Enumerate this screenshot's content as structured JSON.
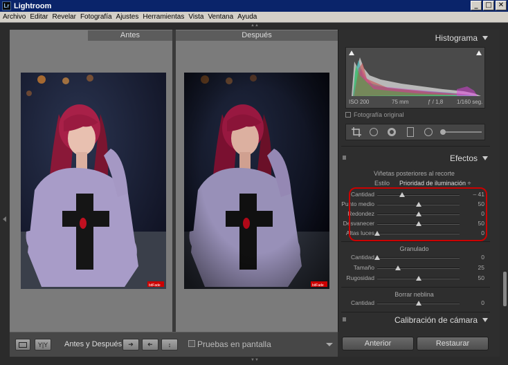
{
  "window": {
    "title": "Lightroom",
    "app_icon": "Lr",
    "min": "_",
    "max": "□",
    "close": "✕"
  },
  "menu": [
    "Archivo",
    "Editar",
    "Revelar",
    "Fotografía",
    "Ajustes",
    "Herramientas",
    "Vista",
    "Ventana",
    "Ayuda"
  ],
  "compare": {
    "before_label": "Antes",
    "after_label": "Después",
    "watermark": "bitFade"
  },
  "toolbar": {
    "view_label": "Y|Y",
    "before_after_label": "Antes y Después:",
    "soft_proof_label": "Pruebas en pantalla"
  },
  "histogram": {
    "title": "Histograma",
    "iso": "ISO 200",
    "focal": "75 mm",
    "aperture": "ƒ / 1,8",
    "shutter": "1/160 seg.",
    "original_photo": "Fotografía original"
  },
  "effects": {
    "title": "Efectos",
    "vignette_title": "Viñetas posteriores al recorte",
    "style_label": "Estilo",
    "style_value": "Prioridad de iluminación ÷",
    "vignette": [
      {
        "label": "Cantidad",
        "value": "– 41",
        "pos": 0.3
      },
      {
        "label": "Punto medio",
        "value": "50",
        "pos": 0.5
      },
      {
        "label": "Redondez",
        "value": "0",
        "pos": 0.5
      },
      {
        "label": "Desvanecer",
        "value": "50",
        "pos": 0.5
      },
      {
        "label": "Altas luces",
        "value": "0",
        "pos": 0.0
      }
    ],
    "grain_title": "Granulado",
    "grain": [
      {
        "label": "Cantidad",
        "value": "0",
        "pos": 0.0
      },
      {
        "label": "Tamaño",
        "value": "25",
        "pos": 0.25
      },
      {
        "label": "Rugosidad",
        "value": "50",
        "pos": 0.5
      }
    ],
    "dehaze_title": "Borrar neblina",
    "dehaze": [
      {
        "label": "Cantidad",
        "value": "0",
        "pos": 0.5
      }
    ]
  },
  "calibration": {
    "title": "Calibración de cámara"
  },
  "buttons": {
    "previous": "Anterior",
    "reset": "Restaurar"
  }
}
